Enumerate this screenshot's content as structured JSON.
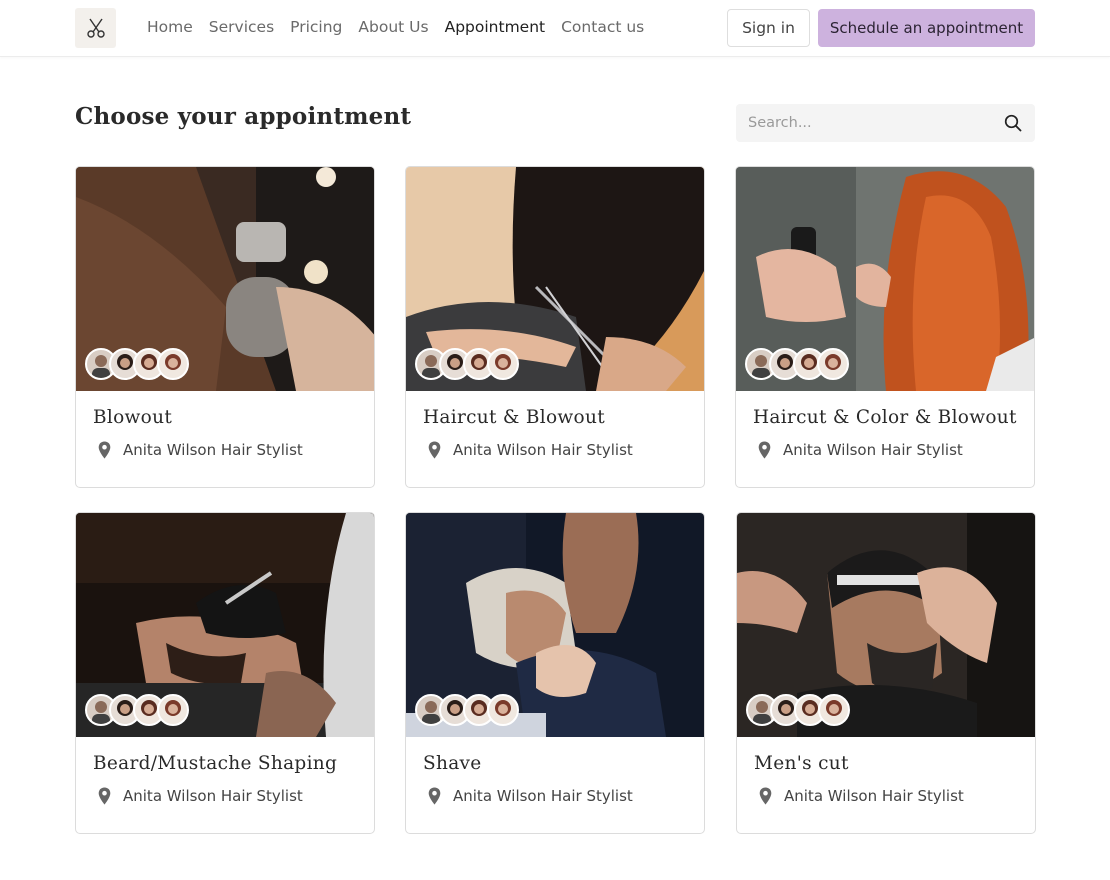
{
  "header": {
    "logo_icon": "scissors-icon",
    "nav": [
      "Home",
      "Services",
      "Pricing",
      "About Us",
      "Appointment",
      "Contact us"
    ],
    "active_nav": "Appointment",
    "sign_in": "Sign in",
    "schedule": "Schedule an appointment",
    "accent_color": "#cdb2de"
  },
  "main": {
    "title": "Choose your appointment",
    "search": {
      "placeholder": "Search...",
      "icon": "search-icon"
    }
  },
  "services": [
    {
      "name": "Blowout",
      "location": "Anita Wilson Hair Stylist"
    },
    {
      "name": "Haircut & Blowout",
      "location": "Anita Wilson Hair Stylist"
    },
    {
      "name": "Haircut & Color & Blowout",
      "location": "Anita Wilson Hair Stylist"
    },
    {
      "name": "Beard/Mustache Shaping",
      "location": "Anita Wilson Hair Stylist"
    },
    {
      "name": "Shave",
      "location": "Anita Wilson Hair Stylist"
    },
    {
      "name": "Men's cut",
      "location": "Anita Wilson Hair Stylist"
    }
  ]
}
